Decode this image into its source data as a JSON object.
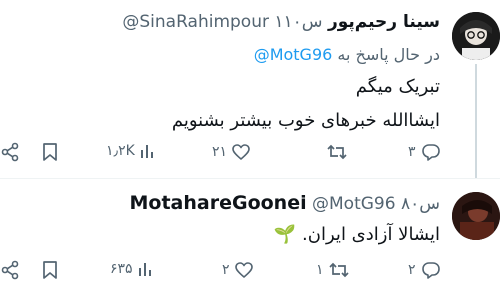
{
  "tweet1": {
    "display_name": "سینا رحیم‌پور",
    "handle": "@SinaRahimpour",
    "time": "۱۱۰س",
    "replying_label": "در حال پاسخ به",
    "replying_to": "@MotG96",
    "text_line1": "تبریک میگم",
    "text_line2": "ایشاالله خبرهای خوب بیشتر بشنویم",
    "views": "۱٫۲K",
    "likes": "۲۱",
    "retweets": "",
    "replies": "۳"
  },
  "tweet2": {
    "display_name": "MotahareGoonei",
    "handle": "@MotG96",
    "time": "۸۰س",
    "text": "ایشالا آزادی ایران. 🌱",
    "views": "۶۳۵",
    "likes": "۲",
    "retweets": "۱",
    "replies": "۲"
  },
  "icons": [
    "share-icon",
    "bookmark-icon",
    "views-icon",
    "like-icon",
    "retweet-icon",
    "reply-icon"
  ],
  "colors": {
    "text": "#0f1419",
    "muted": "#536471",
    "link": "#1d9bf0",
    "divider": "#eff3f4"
  }
}
